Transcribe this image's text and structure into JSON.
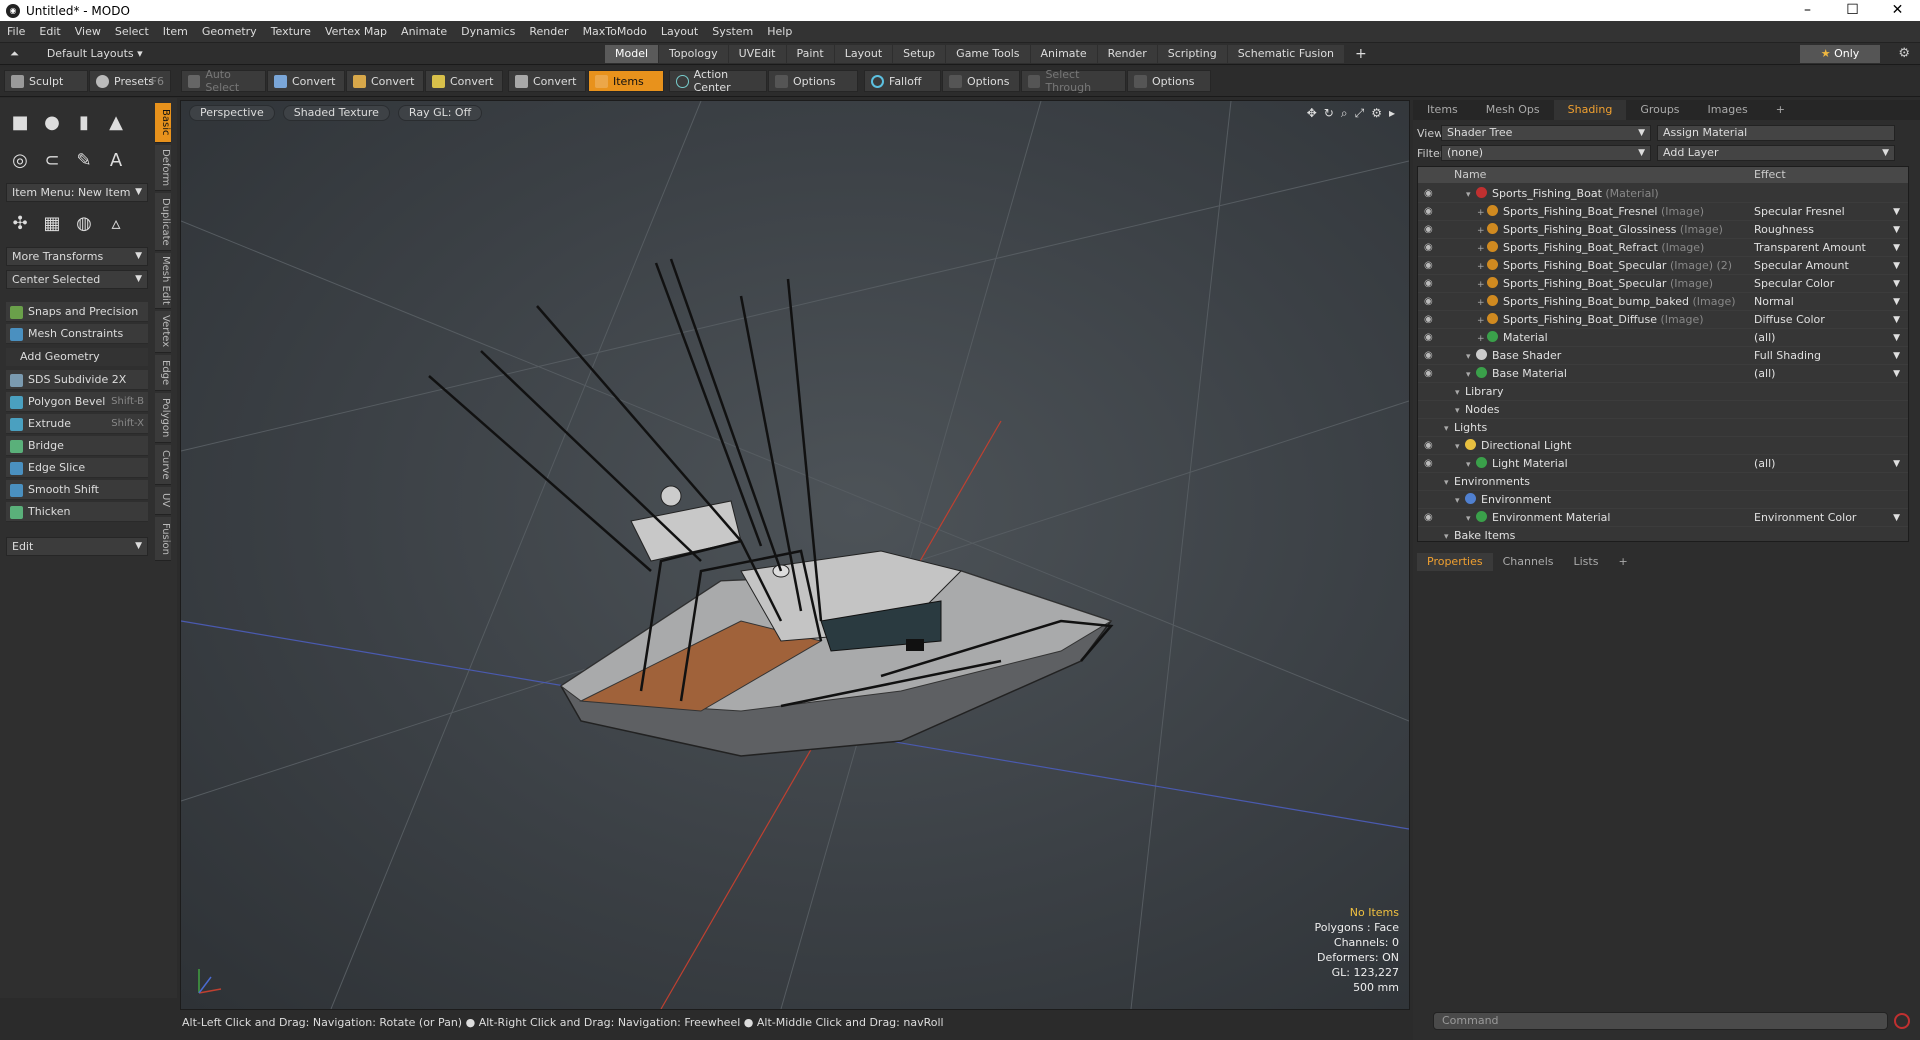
{
  "window": {
    "title": "Untitled* - MODO"
  },
  "menu": [
    "File",
    "Edit",
    "View",
    "Select",
    "Item",
    "Geometry",
    "Texture",
    "Vertex Map",
    "Animate",
    "Dynamics",
    "Render",
    "MaxToModo",
    "Layout",
    "System",
    "Help"
  ],
  "layout": {
    "preset": "Default Layouts",
    "tabs": [
      "Model",
      "Topology",
      "UVEdit",
      "Paint",
      "Layout",
      "Setup",
      "Game Tools",
      "Animate",
      "Render",
      "Scripting",
      "Schematic Fusion"
    ],
    "active_tab": "Model",
    "only_label": "Only"
  },
  "toolbar": {
    "sculpt": "Sculpt",
    "presets": "Presets",
    "presets_key": "F6",
    "auto_select": "Auto Select",
    "convert1": "Convert",
    "convert2": "Convert",
    "convert3": "Convert",
    "convert4": "Convert",
    "items": "Items",
    "action_center": "Action Center",
    "options1": "Options",
    "falloff": "Falloff",
    "options2": "Options",
    "select_through": "Select Through",
    "options3": "Options"
  },
  "left": {
    "vtabs": [
      "Basic",
      "Deform",
      "Duplicate",
      "Mesh Edit",
      "Vertex",
      "Edge",
      "Polygon",
      "Curve",
      "UV",
      "Fusion"
    ],
    "item_menu": "Item Menu: New Item",
    "more_transforms": "More Transforms",
    "center_selected": "Center Selected",
    "snaps": "Snaps and Precision",
    "mesh_constraints": "Mesh Constraints",
    "add_geometry": "Add Geometry",
    "tools": [
      {
        "label": "SDS Subdivide 2X",
        "key": ""
      },
      {
        "label": "Polygon Bevel",
        "key": "Shift-B"
      },
      {
        "label": "Extrude",
        "key": "Shift-X"
      },
      {
        "label": "Bridge",
        "key": ""
      },
      {
        "label": "Edge Slice",
        "key": ""
      },
      {
        "label": "Smooth Shift",
        "key": ""
      },
      {
        "label": "Thicken",
        "key": ""
      }
    ],
    "edit": "Edit"
  },
  "viewport": {
    "view": "Perspective",
    "shading": "Shaded Texture",
    "raygl": "Ray GL: Off",
    "info": {
      "items": "No Items",
      "polygons": "Polygons : Face",
      "channels": "Channels: 0",
      "deformers": "Deformers: ON",
      "gl": "GL: 123,227",
      "scale": "500 mm"
    }
  },
  "statusbar": "Alt-Left Click and Drag: Navigation: Rotate (or Pan) ● Alt-Right Click and Drag: Navigation: Freewheel ● Alt-Middle Click and Drag: navRoll",
  "right": {
    "tabs": [
      "Items",
      "Mesh Ops",
      "Shading",
      "Groups",
      "Images"
    ],
    "active_tab": "Shading",
    "view_label": "View",
    "view_value": "Shader Tree",
    "assign": "Assign Material",
    "filter_label": "Filter",
    "filter_value": "(none)",
    "add_layer": "Add Layer",
    "col_name": "Name",
    "col_effect": "Effect",
    "tree": [
      {
        "name": "Sports_Fishing_Boat",
        "type": "(Material)",
        "effect": "",
        "indent": 2,
        "color": "#c03030"
      },
      {
        "name": "Sports_Fishing_Boat_Fresnel",
        "type": "(Image)",
        "effect": "Specular Fresnel",
        "indent": 3,
        "color": "#d08a20"
      },
      {
        "name": "Sports_Fishing_Boat_Glossiness",
        "type": "(Image)",
        "effect": "Roughness",
        "indent": 3,
        "color": "#d08a20"
      },
      {
        "name": "Sports_Fishing_Boat_Refract",
        "type": "(Image)",
        "effect": "Transparent Amount",
        "indent": 3,
        "color": "#d08a20"
      },
      {
        "name": "Sports_Fishing_Boat_Specular",
        "type": "(Image) (2)",
        "effect": "Specular Amount",
        "indent": 3,
        "color": "#d08a20"
      },
      {
        "name": "Sports_Fishing_Boat_Specular",
        "type": "(Image)",
        "effect": "Specular Color",
        "indent": 3,
        "color": "#d08a20"
      },
      {
        "name": "Sports_Fishing_Boat_bump_baked",
        "type": "(Image)",
        "effect": "Normal",
        "indent": 3,
        "color": "#d08a20"
      },
      {
        "name": "Sports_Fishing_Boat_Diffuse",
        "type": "(Image)",
        "effect": "Diffuse Color",
        "indent": 3,
        "color": "#d08a20"
      },
      {
        "name": "Material",
        "type": "",
        "effect": "(all)",
        "indent": 3,
        "color": "#3aa04a"
      },
      {
        "name": "Base Shader",
        "type": "",
        "effect": "Full Shading",
        "indent": 2,
        "color": "#cccccc"
      },
      {
        "name": "Base Material",
        "type": "",
        "effect": "(all)",
        "indent": 2,
        "color": "#3aa04a"
      },
      {
        "name": "Library",
        "type": "",
        "effect": "",
        "indent": 1,
        "color": ""
      },
      {
        "name": "Nodes",
        "type": "",
        "effect": "",
        "indent": 1,
        "color": ""
      },
      {
        "name": "Lights",
        "type": "",
        "effect": "",
        "indent": 0,
        "color": ""
      },
      {
        "name": "Directional Light",
        "type": "",
        "effect": "",
        "indent": 1,
        "color": "#e8c040"
      },
      {
        "name": "Light Material",
        "type": "",
        "effect": "(all)",
        "indent": 2,
        "color": "#3aa04a"
      },
      {
        "name": "Environments",
        "type": "",
        "effect": "",
        "indent": 0,
        "color": ""
      },
      {
        "name": "Environment",
        "type": "",
        "effect": "",
        "indent": 1,
        "color": "#5080d0"
      },
      {
        "name": "Environment Material",
        "type": "",
        "effect": "Environment Color",
        "indent": 2,
        "color": "#3aa04a"
      },
      {
        "name": "Bake Items",
        "type": "",
        "effect": "",
        "indent": 0,
        "color": ""
      }
    ],
    "ptabs": [
      "Properties",
      "Channels",
      "Lists"
    ],
    "active_ptab": "Properties",
    "command_placeholder": "Command"
  }
}
